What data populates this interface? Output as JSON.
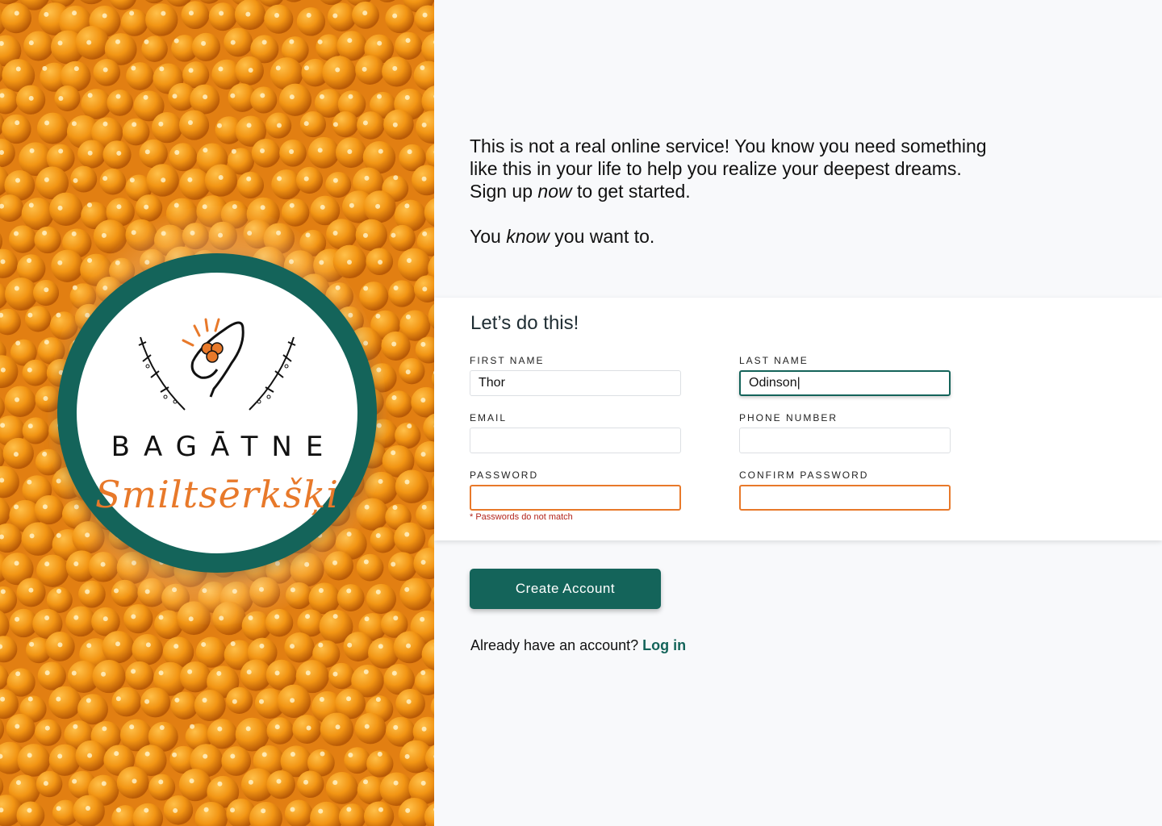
{
  "brand": {
    "name": "BAGĀTNE",
    "script": "Smiltsērkšķi",
    "colors": {
      "primary": "#14645a",
      "accent": "#e8792a",
      "error": "#b3261e"
    }
  },
  "intro": {
    "line1": "This is not a real online service! You know you need something",
    "line2": "like this in your life to help you realize your deepest dreams.",
    "line3_pre": "Sign up ",
    "line3_em": "now",
    "line3_post": " to get started.",
    "line4_pre": "You ",
    "line4_em": "know",
    "line4_post": " you want to."
  },
  "form": {
    "title": "Let’s do this!",
    "first_name": {
      "label": "FIRST NAME",
      "value": "Thor"
    },
    "last_name": {
      "label": "LAST NAME",
      "value": "Odinson|"
    },
    "email": {
      "label": "EMAIL",
      "value": ""
    },
    "phone": {
      "label": "PHONE NUMBER",
      "value": ""
    },
    "password": {
      "label": "PASSWORD",
      "value": "",
      "error": "* Passwords do not match"
    },
    "confirm_password": {
      "label": "CONFIRM PASSWORD",
      "value": ""
    }
  },
  "actions": {
    "create_account": "Create Account",
    "login_prompt": "Already have an account?",
    "login_link": "Log in"
  }
}
